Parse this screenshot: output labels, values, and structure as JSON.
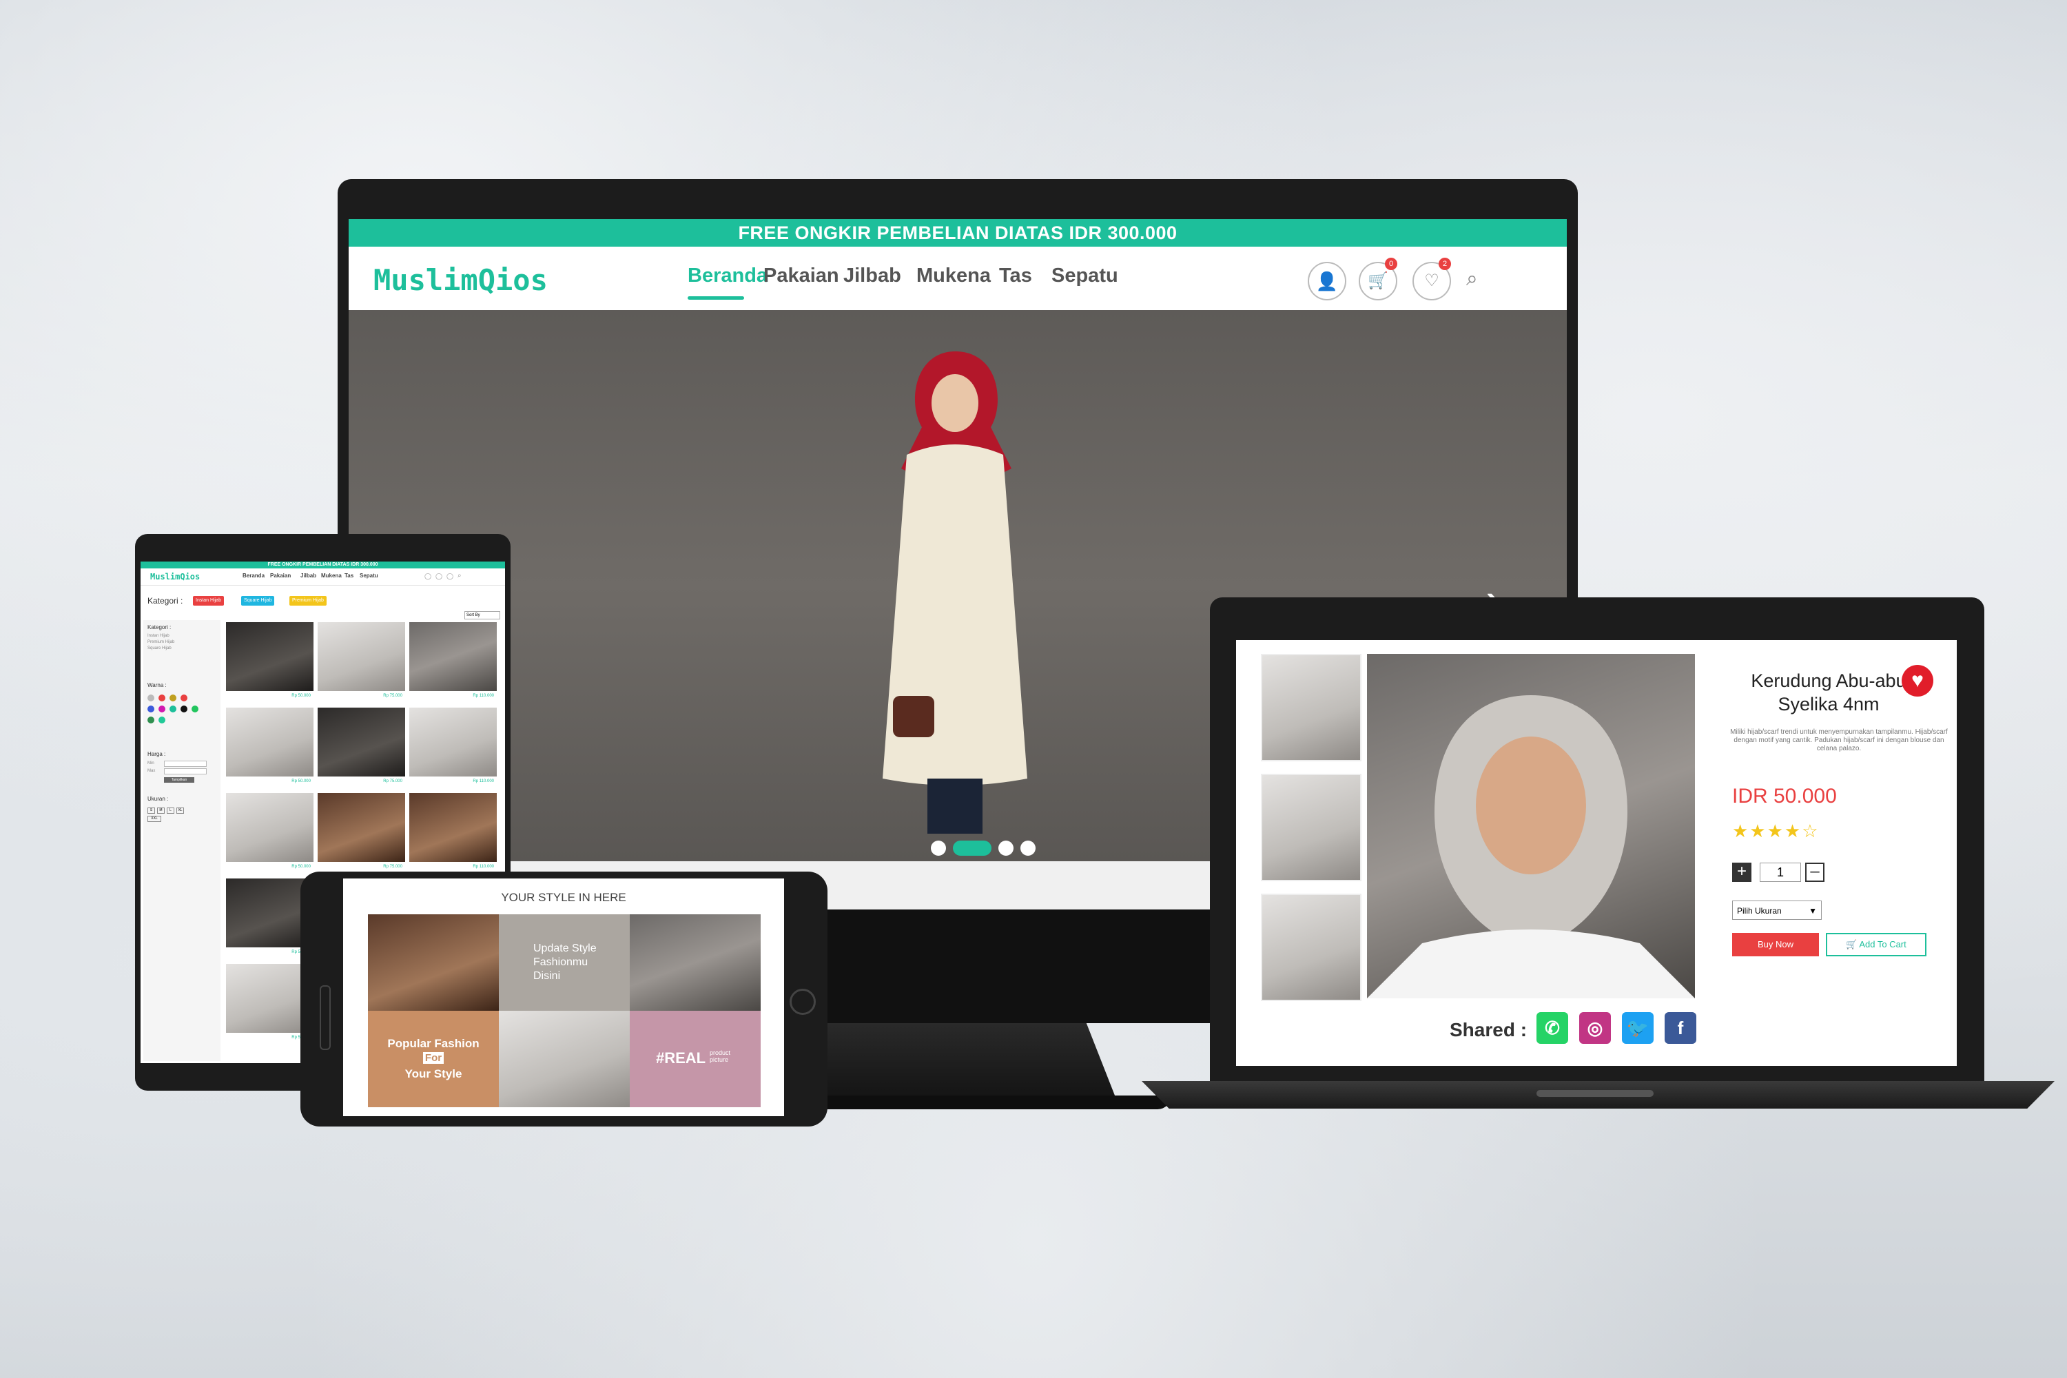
{
  "monitor": {
    "topbar_text": "FREE ONGKIR PEMBELIAN DIATAS IDR 300.000",
    "logo": "MuslimQios",
    "nav": [
      "Beranda",
      "Pakaian",
      "Jilbab",
      "Mukena",
      "Tas",
      "Sepatu"
    ],
    "active_nav": "Beranda",
    "cart_count": "0",
    "wishlist_count": "2",
    "hero_slides": 4,
    "hero_active_slide": 2,
    "next_glyph": "›"
  },
  "tablet": {
    "topbar_text": "FREE ONGKIR PEMBELIAN DIATAS IDR 300.000",
    "logo": "MuslimQios",
    "nav": [
      "Beranda",
      "Pakaian",
      "Jilbab",
      "Mukena",
      "Tas",
      "Sepatu"
    ],
    "kategori_label": "Kategori :",
    "filter_tags": [
      "Instan Hijab",
      "Square Hijab",
      "Premium Hijab"
    ],
    "sort_label": "Sort By",
    "sidebar": {
      "kategori_title": "Kategori :",
      "kategori_items": [
        "Instan Hijab",
        "Premium Hijab",
        "Square Hijab"
      ],
      "warna_title": "Warna :",
      "harga_title": "Harga :",
      "min_label": "Min",
      "max_label": "Max",
      "apply_button": "Tampilkan",
      "ukuran_title": "Ukuran :",
      "sizes": [
        "S",
        "M",
        "L",
        "XL",
        "XXL"
      ]
    },
    "prices": [
      "Rp 50.000",
      "Rp 75.000",
      "Rp 110.000",
      "Rp 50.000",
      "Rp 75.000",
      "Rp 110.000",
      "Rp 50.000",
      "Rp 75.000",
      "Rp 110.000",
      "Rp 50.000",
      "Rp 50.000"
    ]
  },
  "phone": {
    "title": "YOUR STYLE IN HERE",
    "quote": "Update Style Fashionmu Disini",
    "popular_line1": "Popular Fashion",
    "popular_for": "For",
    "popular_line2": "Your Style",
    "real_tag": "#REAL",
    "real_sub": "product picture"
  },
  "laptop": {
    "product_title": "Kerudung Abu-abu Syelika 4nm",
    "description": "Miliki hijab/scarf trendi untuk menyempurnakan tampilanmu. Hijab/scarf dengan motif yang cantik. Padukan hijab/scarf ini dengan blouse dan celana palazo.",
    "price": "IDR 50.000",
    "rating": 4.5,
    "stars": "★★★★☆",
    "qty": "1",
    "size_placeholder": "Pilih Ukuran",
    "buy_now": "Buy Now",
    "add_to_cart": "Add To Cart",
    "shared_label": "Shared :"
  },
  "colors": {
    "accent": "#1dbf9b",
    "red": "#e94040",
    "gold": "#f3c51b"
  }
}
